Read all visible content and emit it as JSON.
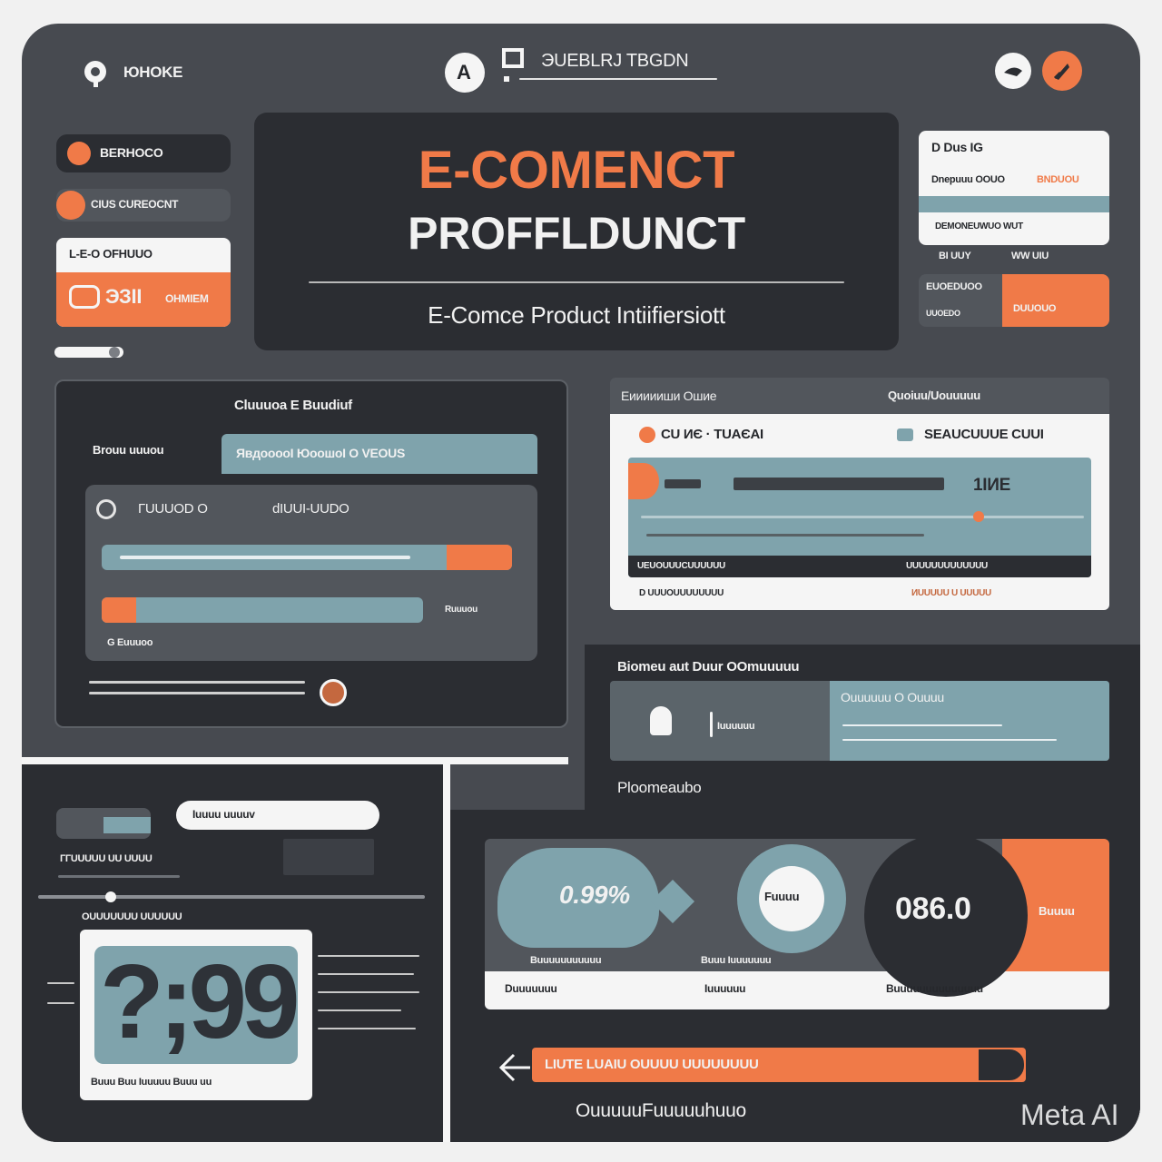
{
  "header": {
    "logo_text": "ЮHOKE",
    "center_badge": "A",
    "search_text": "ЭUEBLRJ TBGDN",
    "icons": [
      "user-icon",
      "rocket-icon"
    ]
  },
  "sidebar": {
    "items": [
      {
        "label": "BERHOCO",
        "icon": "circle-icon"
      },
      {
        "label": "CIUS CUREOCNT",
        "icon": "tag-icon"
      },
      {
        "label": "L-E-O OFHUUO",
        "icon": "cart-icon",
        "body": "ЭЗІІ"
      },
      {
        "label": "OHMIEM",
        "icon": "chart-icon"
      }
    ]
  },
  "hero": {
    "title_line1": "E-COMENCT",
    "title_line2": "PROFFLDUNCT",
    "subtitle": "E-Comce Product Intiifiersiott"
  },
  "card_right": {
    "head": "D Dus IG",
    "line1": "Dnepuuu OOUO",
    "line1_accent": "BNDUOU",
    "line2": "DEMONEUWUO WUT",
    "foot_left": "BI UUY",
    "foot_right": "WW UIU"
  },
  "mini_table": {
    "row1_left": "EUOEDUOO",
    "row2_left": "UUOEDO",
    "right": "DUUOUO"
  },
  "panel_left": {
    "title": "Cluuuoa E Buudiuf",
    "tab_active": "Brouu uuuou",
    "tab_header": "ЯвдооооI ЮоошоI O VEOUS",
    "row_label": "ГUUUOD O",
    "row_value": "dIUUI-UUDO",
    "bar_caption": "Ruuuou",
    "footer_link": "G Euuuoo"
  },
  "panel_product": {
    "head_left": "Еиииииши Ошие",
    "head_right": "Quoiuu/Uouuuuu",
    "item1": "CU ИЄ · ТUAЄAI",
    "item2": "SEAUCUUUE CUUI",
    "price": "1IИE",
    "foot1_left": "UEUOUUUCUUUUUU",
    "foot1_right": "UUUUUUUUUUUUU",
    "foot2_left": "D UUUOUUUUUUUU",
    "foot2_right": "ИUUUUU U UUUUU"
  },
  "panel_reviews": {
    "title": "Biomeu aut Duur  OOmuuuuu",
    "right_head": "Ouuuuuu O Ouuuu",
    "label": "Iuuuuuu",
    "footer": "Ploomeaubo"
  },
  "panel_bottom_left": {
    "pill": "Iuuuu uuuuv",
    "subtitle": "ГГUUUUU UU UUUU",
    "section": "OUUUUUUU UUUUUU",
    "image_text": "?;99",
    "caption": "Buuu Buu Iuuuuu Buuu uu"
  },
  "stats": {
    "bubble": "0.99%",
    "circle": "Fuuuu",
    "value": "086.0",
    "value_label": "Buuuu",
    "cap1": "Buuuuuuuuuuu",
    "cap2": "Buuu Iuuuuuuu",
    "leg1": "Duuuuuuu",
    "leg2": "Iuuuuuu",
    "leg3": "Buuuuuuuuuuuuuu"
  },
  "action_bar": {
    "label": "LIUTE LUAIU OUUUU UUUUUUUU",
    "footer": "OuuuuuFuuuuuhuuo"
  },
  "watermark": "Meta AI",
  "colors": {
    "accent": "#f07a48",
    "teal": "#7fa3ac",
    "dark": "#2b2d32",
    "panel": "#474a50"
  }
}
